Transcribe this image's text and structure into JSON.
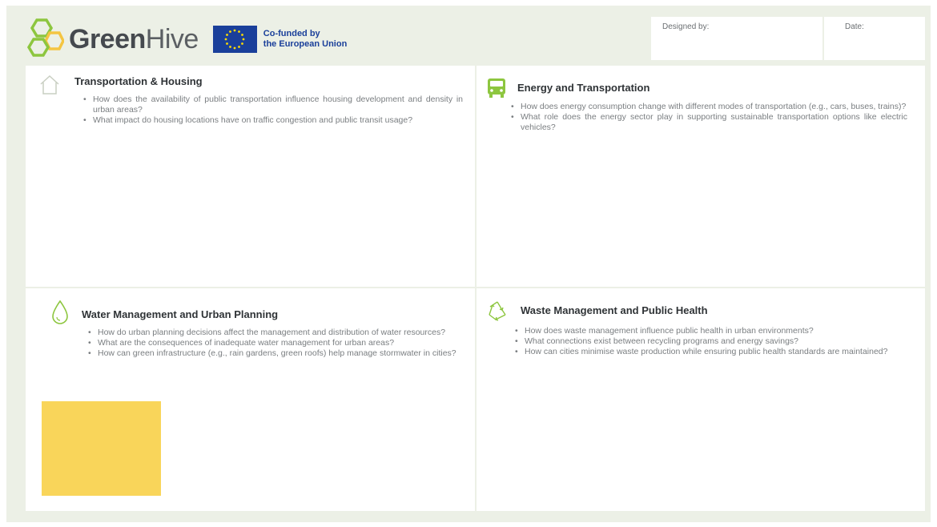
{
  "header": {
    "brand_bold": "Green",
    "brand_light": "Hive",
    "eu_line1": "Co-funded by",
    "eu_line2": "the European Union",
    "designed_by_label": "Designed by:",
    "date_label": "Date:"
  },
  "colors": {
    "board_bg": "#ecf0e6",
    "logo_green": "#8dc63f",
    "logo_yellow": "#f4c542",
    "eu_blue": "#1a3f9a",
    "eu_star": "#ffdd00",
    "sticky_note": "#f9d55a"
  },
  "panels": [
    {
      "icon": "house-icon",
      "title": "Transportation & Housing",
      "questions": [
        "How does the availability of public transportation influence housing development and density in urban areas?",
        "What impact do housing locations have on traffic congestion and public transit usage?"
      ]
    },
    {
      "icon": "bus-icon",
      "title": "Energy and Transportation",
      "questions": [
        "How does energy consumption change with different modes of transportation (e.g., cars, buses, trains)?",
        "What role does the energy sector play in supporting sustainable transportation options like electric vehicles?"
      ]
    },
    {
      "icon": "water-drop-icon",
      "title": "Water Management and Urban Planning",
      "questions": [
        "How do urban planning decisions affect the management and distribution of water resources?",
        "What are the consequences of inadequate water management for urban areas?",
        "How can green infrastructure (e.g., rain gardens, green roofs) help manage stormwater in cities?"
      ]
    },
    {
      "icon": "recycle-icon",
      "title": "Waste Management and Public Health",
      "questions": [
        "How does waste management influence public health in urban environments?",
        "What connections exist between recycling programs and energy savings?",
        "How can cities minimise waste production while ensuring public health standards are maintained?"
      ]
    }
  ]
}
